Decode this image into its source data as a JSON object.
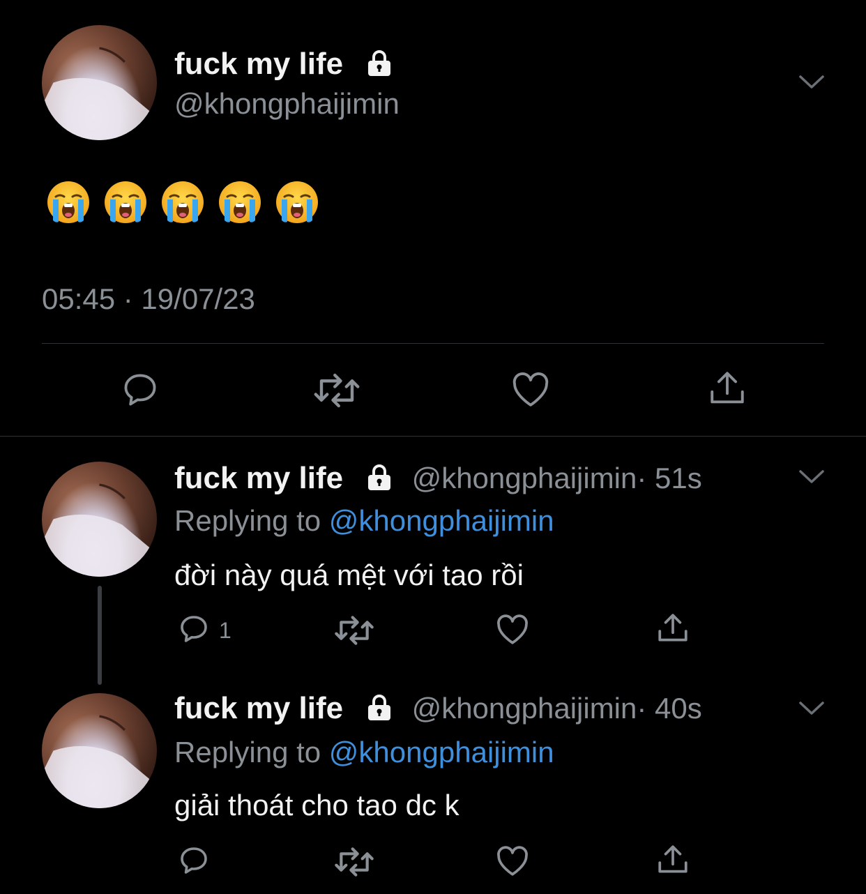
{
  "main_tweet": {
    "display_name": "fuck my life",
    "handle": "@khongphaijimin",
    "emoji_count": 5,
    "emoji_name": "loudly-crying-face",
    "timestamp": "05:45 · 19/07/23"
  },
  "replies": [
    {
      "display_name": "fuck my life",
      "handle": "@khongphaijimin",
      "time": "· 51s",
      "replying_label": "Replying to",
      "replying_handle": "@khongphaijimin",
      "text": "đời này quá mệt với tao rồi",
      "reply_count": "1"
    },
    {
      "display_name": "fuck my life",
      "handle": "@khongphaijimin",
      "time": "· 40s",
      "replying_label": "Replying to",
      "replying_handle": "@khongphaijimin",
      "text": "giải thoát cho tao dc k",
      "reply_count": ""
    }
  ],
  "colors": {
    "background": "#000000",
    "text_primary": "#f2f2f2",
    "text_secondary": "#8b9096",
    "link_blue": "#3f8fdc",
    "separator": "#2f3336"
  }
}
